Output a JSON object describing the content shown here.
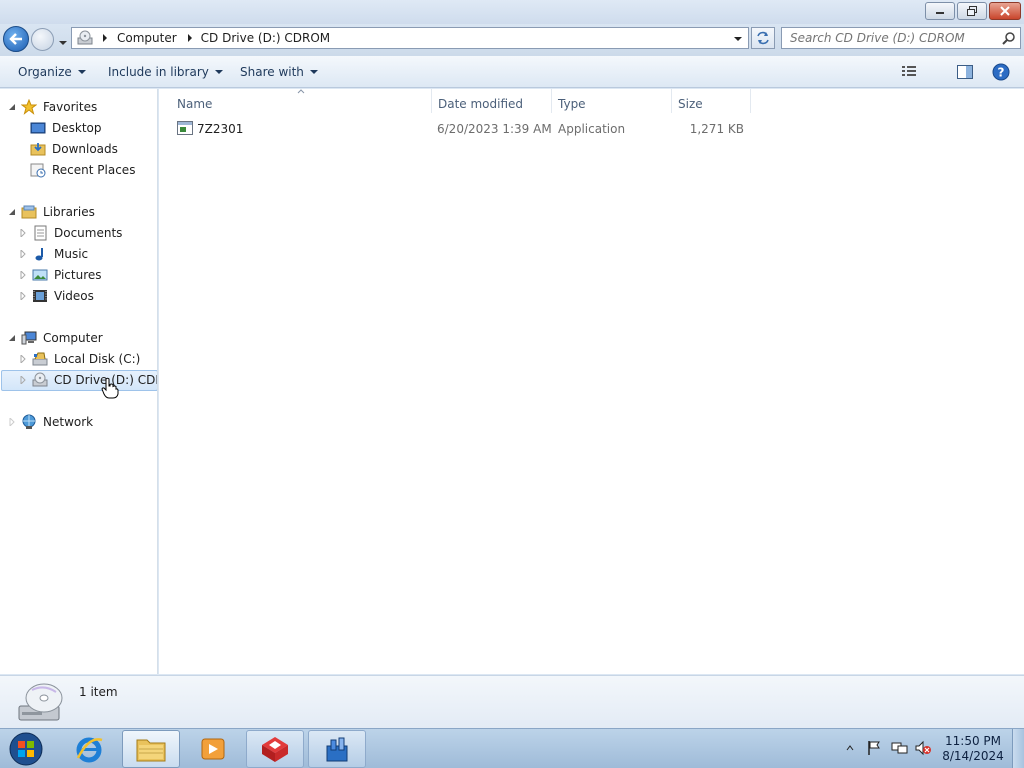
{
  "window": {
    "buttons": [
      "minimize",
      "maximize",
      "close"
    ]
  },
  "navigation": {
    "breadcrumb": [
      "Computer",
      "CD Drive (D:) CDROM"
    ],
    "search_placeholder": "Search CD Drive (D:) CDROM"
  },
  "toolbar": {
    "organize": "Organize",
    "include_in_library": "Include in library",
    "share_with": "Share with"
  },
  "sidebar": {
    "favorites": {
      "label": "Favorites",
      "items": [
        "Desktop",
        "Downloads",
        "Recent Places"
      ]
    },
    "libraries": {
      "label": "Libraries",
      "items": [
        "Documents",
        "Music",
        "Pictures",
        "Videos"
      ]
    },
    "computer": {
      "label": "Computer",
      "items": [
        "Local Disk (C:)",
        "CD Drive (D:) CDROM"
      ],
      "selected": "CD Drive (D:) CDROM"
    },
    "network": {
      "label": "Network"
    }
  },
  "file_list": {
    "columns": [
      "Name",
      "Date modified",
      "Type",
      "Size"
    ],
    "rows": [
      {
        "name": "7Z2301",
        "date_modified": "6/20/2023 1:39 AM",
        "type": "Application",
        "size": "1,271 KB"
      }
    ]
  },
  "details_pane": {
    "item_count": "1 item"
  },
  "taskbar": {
    "pinned": [
      "start-orb",
      "internet-explorer",
      "windows-explorer",
      "windows-media-player",
      "app-red-cube",
      "app-blue-tool"
    ],
    "clock_time": "11:50 PM",
    "clock_date": "8/14/2024"
  },
  "colors": {
    "selection_bg": "#d3e6fa",
    "selection_border": "#9ec3ea",
    "link_text": "#1e395b"
  }
}
